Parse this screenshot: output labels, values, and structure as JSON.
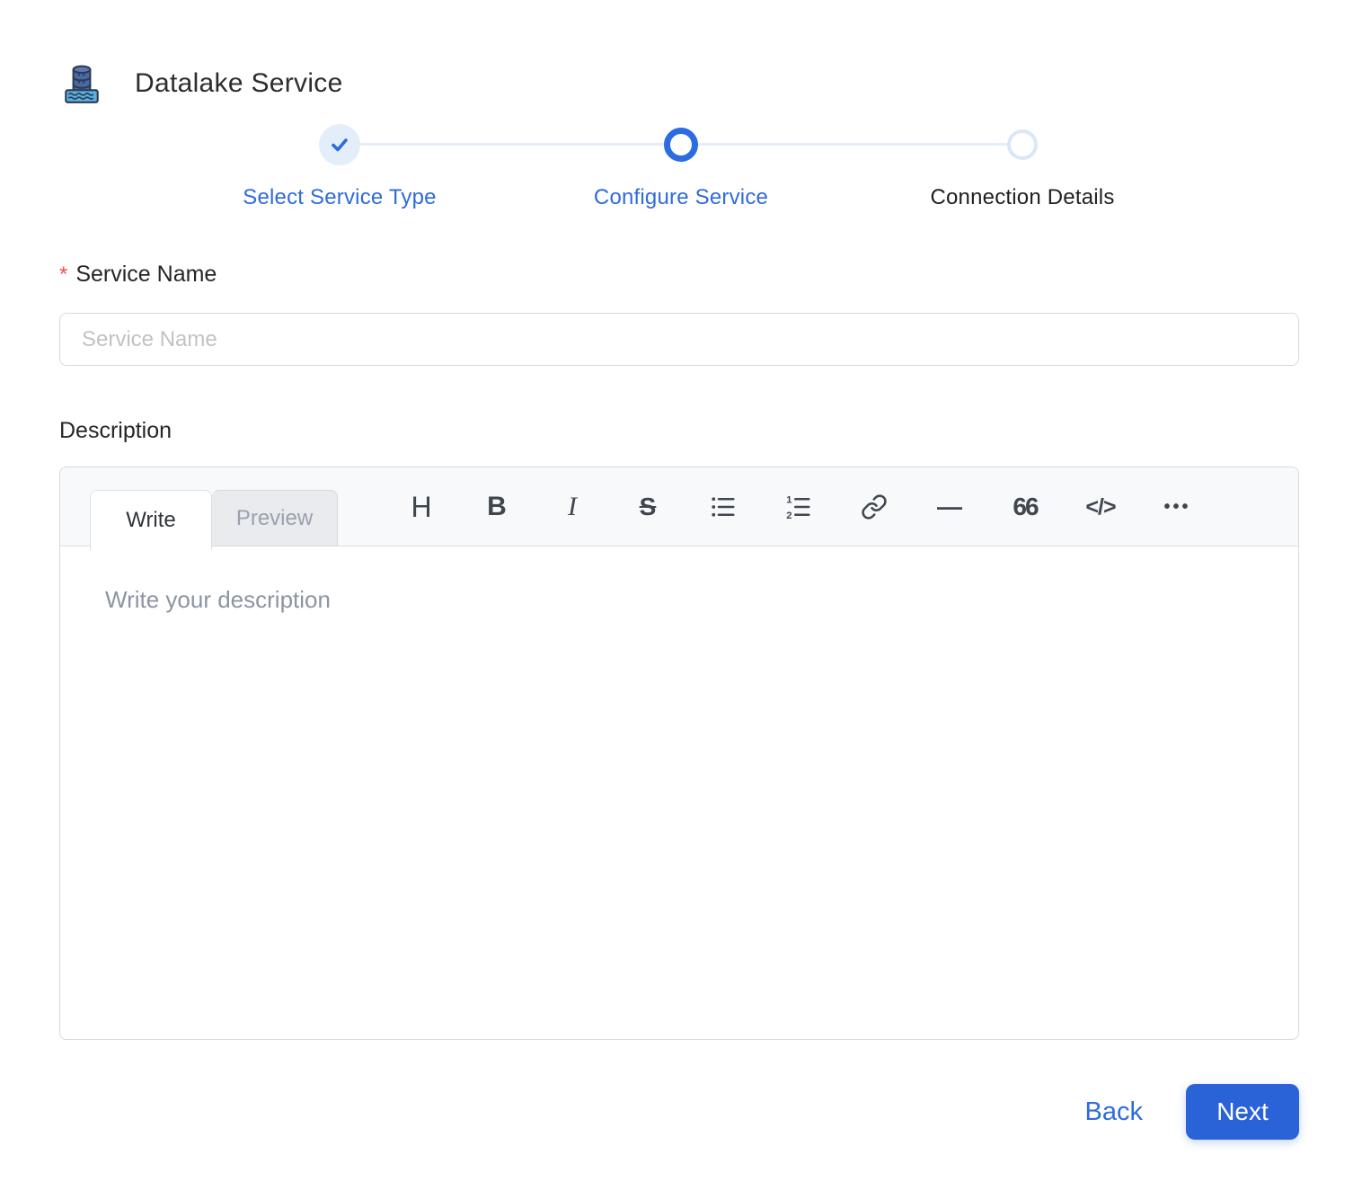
{
  "header": {
    "title": "Datalake Service",
    "icon": "datalake-icon"
  },
  "stepper": {
    "steps": [
      {
        "label": "Select Service Type",
        "state": "completed"
      },
      {
        "label": "Configure Service",
        "state": "active"
      },
      {
        "label": "Connection Details",
        "state": "pending"
      }
    ]
  },
  "form": {
    "service_name": {
      "label": "Service Name",
      "required_mark": "*",
      "placeholder": "Service Name",
      "value": ""
    },
    "description": {
      "label": "Description",
      "tabs": [
        {
          "label": "Write"
        },
        {
          "label": "Preview"
        }
      ],
      "active_tab": "Write",
      "placeholder": "Write your description",
      "value": "",
      "toolbar": [
        {
          "name": "heading",
          "glyph": "H"
        },
        {
          "name": "bold",
          "glyph": "B"
        },
        {
          "name": "italic",
          "glyph": "I"
        },
        {
          "name": "strikethrough",
          "glyph": "S"
        },
        {
          "name": "bullet-list",
          "glyph": ""
        },
        {
          "name": "ordered-list",
          "glyph": ""
        },
        {
          "name": "link",
          "glyph": ""
        },
        {
          "name": "horizontal-rule",
          "glyph": "—"
        },
        {
          "name": "quote",
          "glyph": "66"
        },
        {
          "name": "code",
          "glyph": "</>"
        },
        {
          "name": "more",
          "glyph": "•••"
        }
      ]
    }
  },
  "actions": {
    "back": "Back",
    "next": "Next"
  },
  "colors": {
    "accent_blue": "#2a63d8",
    "step_blue": "#2f6bdb",
    "step_done_bg": "#e4eefb",
    "step_pending_ring": "#d9e7f8",
    "required_red": "#f05252",
    "toolbar_bg": "#f7f9fb",
    "toolbar_icon": "#40464e",
    "placeholder_gray": "#c2c2c2",
    "editor_placeholder": "#8c94a4"
  }
}
